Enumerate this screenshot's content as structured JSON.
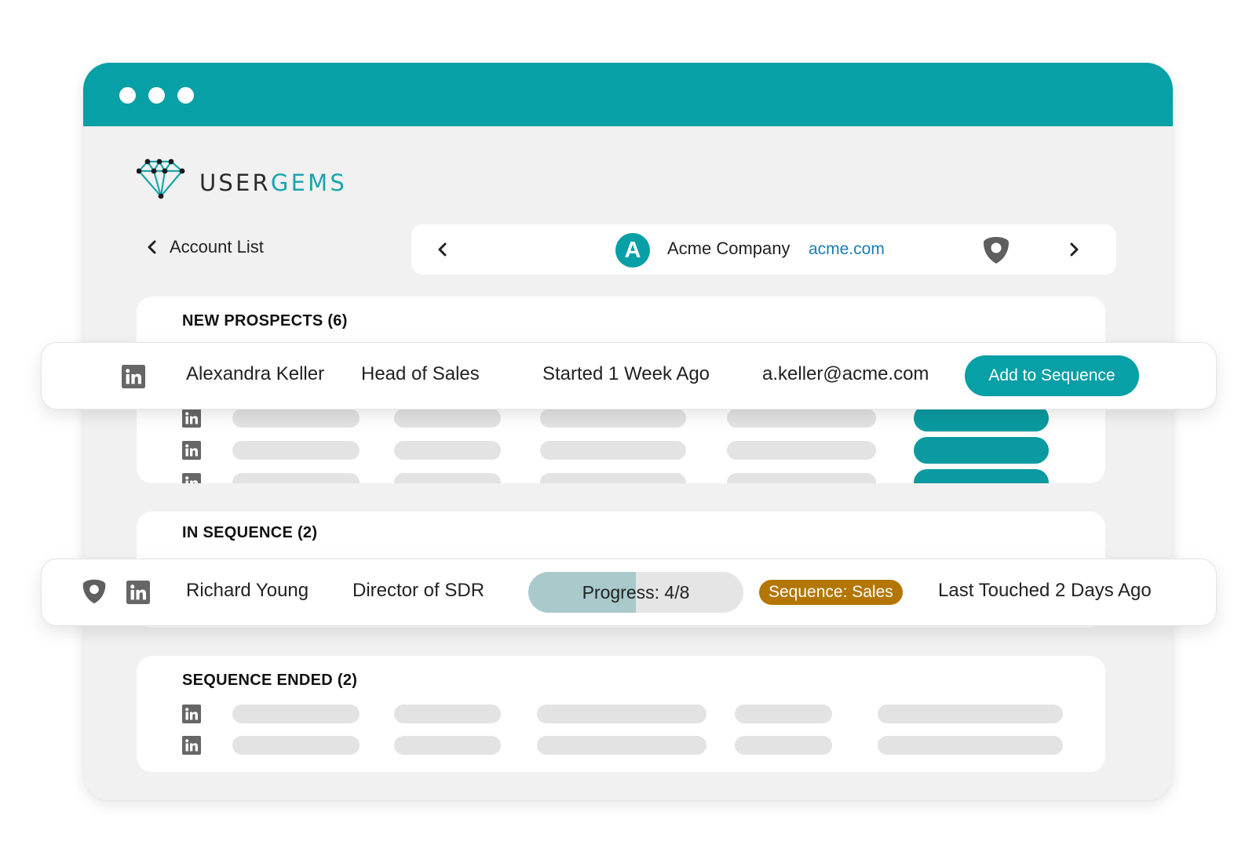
{
  "brand": {
    "name_part1": "USER",
    "name_part2": "GEMS",
    "accent": "#06a0a6"
  },
  "nav": {
    "back_label": "Account List",
    "company_initial": "A",
    "company_name": "Acme Company",
    "company_domain": "acme.com"
  },
  "sections": {
    "new_prospects_title": "NEW PROSPECTS (6)",
    "in_sequence_title": "IN SEQUENCE (2)",
    "sequence_ended_title": "SEQUENCE ENDED (2)"
  },
  "prospect_card": {
    "name": "Alexandra Keller",
    "title": "Head of Sales",
    "started": "Started 1 Week Ago",
    "email": "a.keller@acme.com",
    "action_label": "Add to Sequence"
  },
  "sequence_card": {
    "name": "Richard Young",
    "title": "Director of SDR",
    "progress_label": "Progress: 4/8",
    "progress_fraction": 0.5,
    "sequence_label": "Sequence: Sales",
    "last_touched": "Last Touched 2 Days Ago"
  },
  "icons": [
    "linkedin-icon",
    "shield-icon",
    "chevron-left-icon",
    "chevron-right-icon",
    "diamond-logo-icon"
  ]
}
